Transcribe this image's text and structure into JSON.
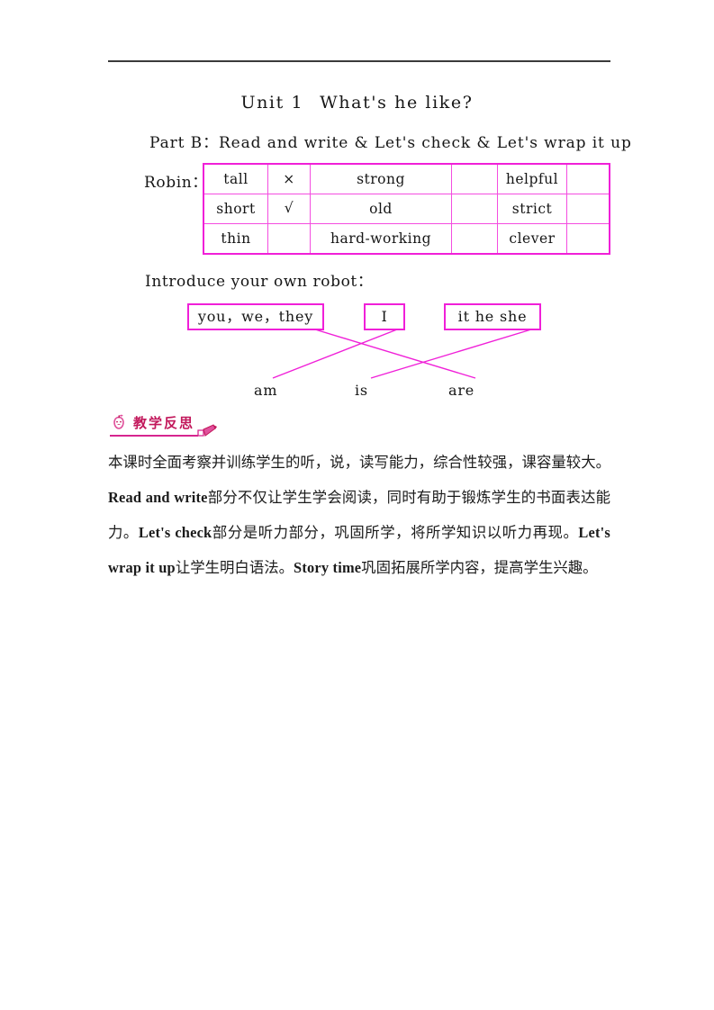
{
  "document": {
    "worksheet": {
      "title_unit": "Unit 1",
      "title_question": "What's he like?",
      "part_line": "Part B：Read and write & Let's check & Let's wrap it up",
      "robin_label": "Robin：",
      "introduce_label": "Introduce your own robot：",
      "table": {
        "rows": [
          [
            "tall",
            "×",
            "strong",
            "",
            "helpful",
            ""
          ],
          [
            "short",
            "√",
            "old",
            "",
            "strict",
            ""
          ],
          [
            "thin",
            "",
            "hard-working",
            "",
            "clever",
            ""
          ]
        ]
      },
      "match_exercise": {
        "pronoun_boxes": [
          {
            "label": "you，we，they"
          },
          {
            "label": "I"
          },
          {
            "label": "it he she"
          }
        ],
        "verbs": [
          {
            "label": "am"
          },
          {
            "label": "is"
          },
          {
            "label": "are"
          }
        ],
        "connections": [
          {
            "from": "you,we,they",
            "to": "are"
          },
          {
            "from": "I",
            "to": "am"
          },
          {
            "from": "it he she",
            "to": "is"
          }
        ]
      }
    },
    "reflection": {
      "heading": "教学反思",
      "paragraph_segments": [
        {
          "text": "本课时全面考察并训练学生的听，说，读写能力，综合性较强，课容量较大。",
          "style": "cn"
        },
        {
          "text": "Read and write",
          "style": "en"
        },
        {
          "text": "部分不仅让学生学会阅读，同时有助于锻炼学生的书面表达能力。",
          "style": "cn"
        },
        {
          "text": "Let's check",
          "style": "en"
        },
        {
          "text": "部分是听力部分，巩固所学，将所学知识以听力再现。",
          "style": "cn"
        },
        {
          "text": "Let's wrap it up",
          "style": "en"
        },
        {
          "text": "让学生明白语法。",
          "style": "cn"
        },
        {
          "text": "Story time",
          "style": "en"
        },
        {
          "text": "巩固拓展所学内容，提高学生兴趣。",
          "style": "cn"
        }
      ]
    },
    "colors": {
      "magenta": "#f020d8",
      "magenta_light": "#f44de0",
      "pink_accent": "#d6258f",
      "heading_pink": "#c2185b",
      "rule_dark": "#3a3a3a"
    }
  }
}
